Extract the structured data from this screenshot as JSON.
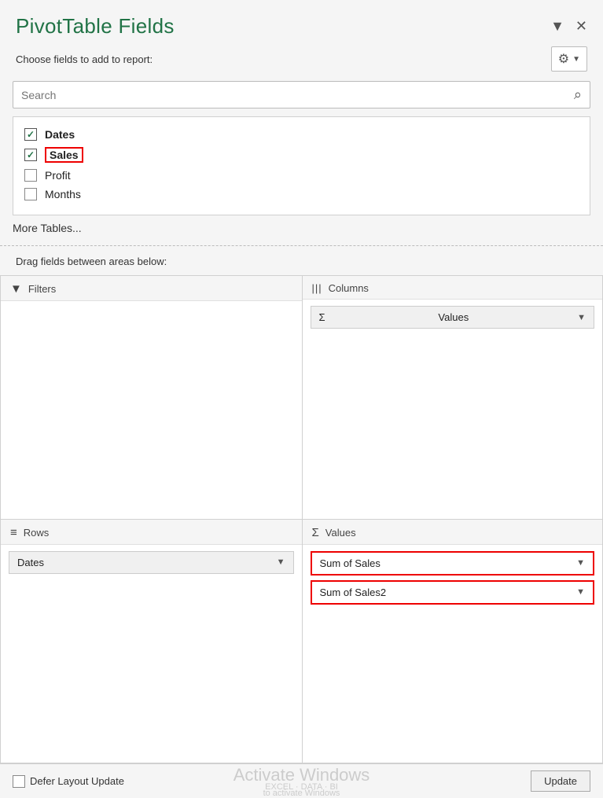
{
  "panel": {
    "title": "PivotTable Fields",
    "subtitle_label": "Choose fields to add to report:"
  },
  "header_icons": {
    "dropdown_icon": "▼",
    "close_icon": "✕"
  },
  "gear_button": {
    "icon": "⚙",
    "arrow": "▼"
  },
  "search": {
    "placeholder": "Search",
    "icon": "🔍"
  },
  "fields": [
    {
      "id": "dates",
      "label": "Dates",
      "checked": true,
      "bold": true,
      "highlighted": false
    },
    {
      "id": "sales",
      "label": "Sales",
      "checked": true,
      "bold": true,
      "highlighted": true
    },
    {
      "id": "profit",
      "label": "Profit",
      "checked": false,
      "bold": false,
      "highlighted": false
    },
    {
      "id": "months",
      "label": "Months",
      "checked": false,
      "bold": false,
      "highlighted": false
    }
  ],
  "more_tables": "More Tables...",
  "drag_label": "Drag fields between areas below:",
  "areas": {
    "filters": {
      "label": "Filters",
      "icon": "▼",
      "chips": []
    },
    "columns": {
      "label": "Columns",
      "icon": "|||",
      "chips": [
        {
          "label": "Values",
          "prefix": "Σ",
          "highlighted": false
        }
      ]
    },
    "rows": {
      "label": "Rows",
      "icon": "≡",
      "chips": [
        {
          "label": "Dates",
          "prefix": "",
          "highlighted": false
        }
      ]
    },
    "values": {
      "label": "Values",
      "icon": "Σ",
      "chips": [
        {
          "label": "Sum of Sales",
          "prefix": "",
          "highlighted": true
        },
        {
          "label": "Sum of Sales2",
          "prefix": "",
          "highlighted": true
        }
      ]
    }
  },
  "bottom": {
    "defer_label": "Defer Layout Update",
    "update_label": "Update",
    "watermark_line1": "Activate Windows",
    "watermark_line2": "EXCEL · DATA · BI",
    "watermark_line3": "to activate Windows"
  }
}
